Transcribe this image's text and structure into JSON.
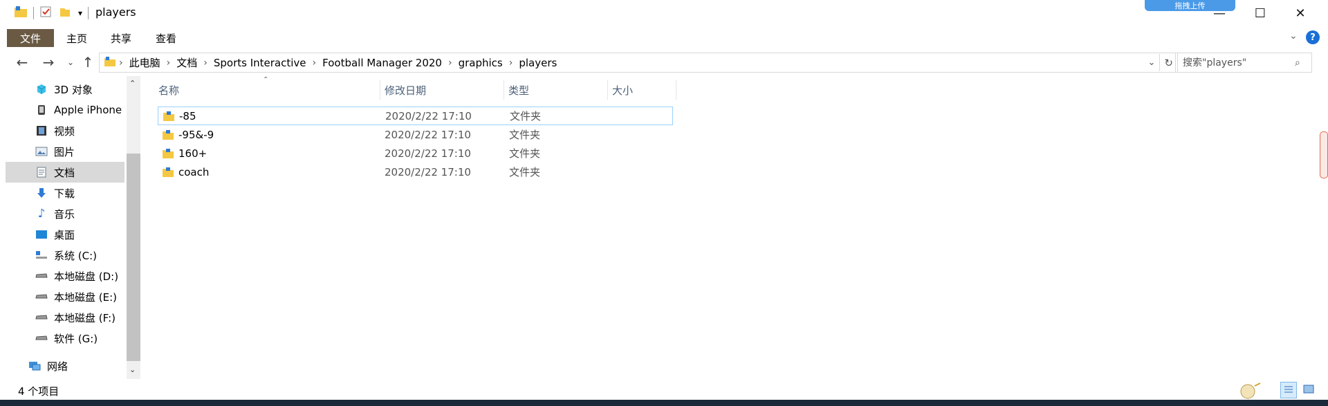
{
  "window": {
    "title": "players",
    "controls": {
      "minimize": "—",
      "maximize": "☐",
      "close": "✕"
    }
  },
  "upload_widget": {
    "label": "拖拽上传"
  },
  "ribbon": {
    "tabs": [
      {
        "label": "文件"
      },
      {
        "label": "主页"
      },
      {
        "label": "共享"
      },
      {
        "label": "查看"
      }
    ],
    "help": "?"
  },
  "breadcrumb": [
    {
      "label": "此电脑"
    },
    {
      "label": "文档"
    },
    {
      "label": "Sports Interactive"
    },
    {
      "label": "Football Manager 2020"
    },
    {
      "label": "graphics"
    },
    {
      "label": "players"
    }
  ],
  "search": {
    "placeholder": "搜索\"players\""
  },
  "nav_pane": {
    "items": [
      {
        "label": "3D 对象",
        "icon": "3d-objects-icon",
        "selected": false
      },
      {
        "label": "Apple iPhone",
        "icon": "phone-icon",
        "selected": false
      },
      {
        "label": "视频",
        "icon": "video-icon",
        "selected": false
      },
      {
        "label": "图片",
        "icon": "picture-icon",
        "selected": false
      },
      {
        "label": "文档",
        "icon": "document-icon",
        "selected": true
      },
      {
        "label": "下载",
        "icon": "download-icon",
        "selected": false
      },
      {
        "label": "音乐",
        "icon": "music-icon",
        "selected": false
      },
      {
        "label": "桌面",
        "icon": "desktop-icon",
        "selected": false
      },
      {
        "label": "系统 (C:)",
        "icon": "system-drive-icon",
        "selected": false
      },
      {
        "label": "本地磁盘 (D:)",
        "icon": "drive-icon",
        "selected": false
      },
      {
        "label": "本地磁盘 (E:)",
        "icon": "drive-icon",
        "selected": false
      },
      {
        "label": "本地磁盘 (F:)",
        "icon": "drive-icon",
        "selected": false
      },
      {
        "label": "软件 (G:)",
        "icon": "drive-icon",
        "selected": false
      },
      {
        "label": "网络",
        "icon": "network-icon",
        "selected": false
      }
    ]
  },
  "columns": [
    {
      "label": "名称"
    },
    {
      "label": "修改日期"
    },
    {
      "label": "类型"
    },
    {
      "label": "大小"
    }
  ],
  "files": [
    {
      "name": "-85",
      "date": "2020/2/22 17:10",
      "type": "文件夹",
      "selected": true
    },
    {
      "name": "-95&-9",
      "date": "2020/2/22 17:10",
      "type": "文件夹",
      "selected": false
    },
    {
      "name": "160+",
      "date": "2020/2/22 17:10",
      "type": "文件夹",
      "selected": false
    },
    {
      "name": "coach",
      "date": "2020/2/22 17:10",
      "type": "文件夹",
      "selected": false
    }
  ],
  "status": {
    "item_count": "4 个项目"
  },
  "colors": {
    "file_tab": "#6b5a43",
    "selection_border": "#99d1ff",
    "nav_selected": "#d9d9d9",
    "header_text": "#4c607a"
  }
}
